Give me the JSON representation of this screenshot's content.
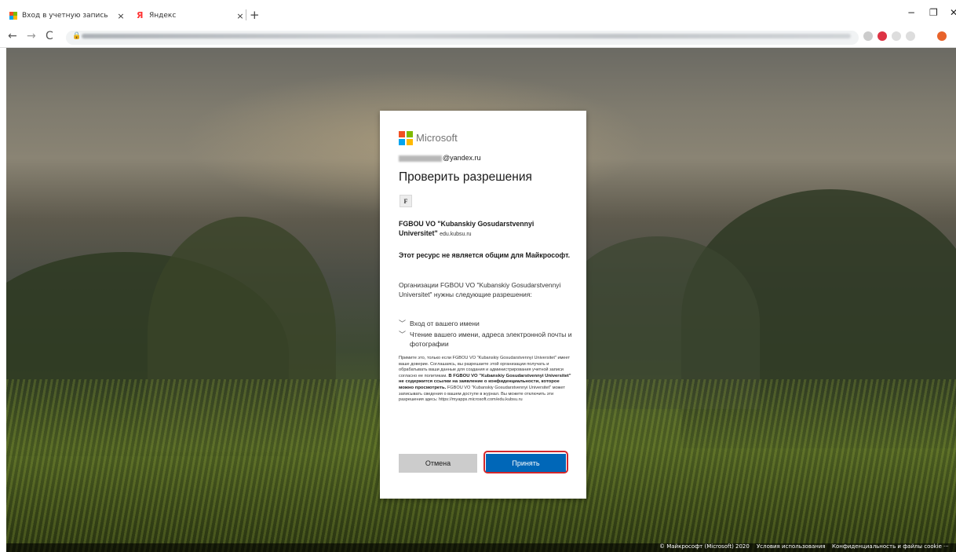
{
  "browser": {
    "tabs": [
      {
        "title": "Вход в учетную запись",
        "close": "×"
      },
      {
        "title": "Яндекс",
        "close": "×"
      }
    ],
    "new_tab": "+",
    "window_controls": {
      "minimize": "−",
      "restore": "❐",
      "close": "✕"
    },
    "nav": {
      "back": "←",
      "forward": "→",
      "reload": "C"
    }
  },
  "dialog": {
    "brand": "Microsoft",
    "email_suffix": "@yandex.ru",
    "heading": "Проверить разрешения",
    "app_initial": "F",
    "org_name": "FGBOU VO \"Kubanskiy Gosudarstvennyi Universitet\"",
    "org_domain": "edu.kubsu.ru",
    "warning": "Этот ресурс не является общим для Майкрософт.",
    "intro": "Организации FGBOU VO \"Kubanskiy Gosudarstvennyi Universitet\" нужны следующие разрешения:",
    "permissions": [
      "Вход от вашего имени",
      "Чтение вашего имени, адреса электронной почты и фотографии"
    ],
    "fine_print_1": "Примите это, только если FGBOU VO \"Kubanskiy Gosudarstvennyi Universitet\" имеет ваше доверие. Соглашаясь, вы разрешаете этой организации получать и обрабатывать ваши данные для создания и администрирования учетной записи согласно ее политикам.",
    "fine_print_bold": "В FGBOU VO \"Kubanskiy Gosudarstvennyi Universitet\" не содержится ссылки на заявление о конфиденциальности, которое можно просмотреть.",
    "fine_print_2": "FGBOU VO \"Kubanskiy Gosudarstvennyi Universitet\" может записывать сведения о вашем доступе в журнал. Вы можете отключить эти разрешения здесь: https://myapps.microsoft.com/edu.kubsu.ru",
    "cancel_label": "Отмена",
    "accept_label": "Принять",
    "colors": {
      "accept": "#0067b8",
      "highlight": "#d3272b",
      "cancel": "#cccccc"
    }
  },
  "footer": {
    "copyright": "© Майкрософт (Microsoft) 2020",
    "terms": "Условия использования",
    "privacy": "Конфиденциальность и файлы cookie",
    "more": "···"
  }
}
